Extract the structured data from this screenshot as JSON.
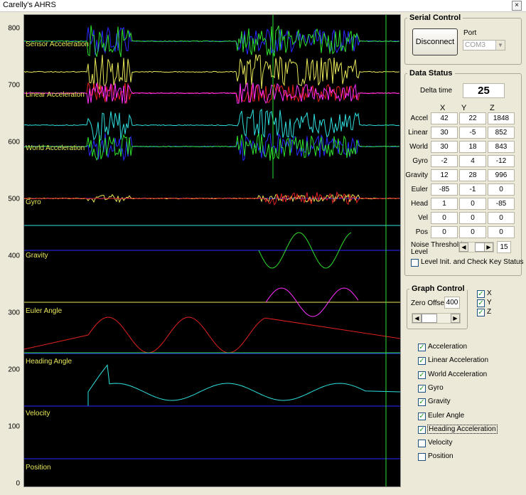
{
  "window": {
    "title": "Carelly's AHRS",
    "close_glyph": "×"
  },
  "y_axis": {
    "ticks": [
      "800",
      "700",
      "600",
      "500",
      "400",
      "300",
      "200",
      "100",
      "0"
    ]
  },
  "graph_labels": [
    "Sensor Acceleration",
    "Linear Acceleraton",
    "World Acceleration",
    "Gyro",
    "Gravity",
    "Euler Angle",
    "Heading Angle",
    "Velocity",
    "Position"
  ],
  "serial_control": {
    "title": "Serial Control",
    "disconnect_label": "Disconnect",
    "port_label": "Port",
    "port_value": "COM3"
  },
  "data_status": {
    "title": "Data Status",
    "delta_time_label": "Delta time",
    "delta_time_value": "25",
    "columns": [
      "X",
      "Y",
      "Z"
    ],
    "rows": [
      {
        "label": "Accel",
        "x": "42",
        "y": "22",
        "z": "1848"
      },
      {
        "label": "Linear",
        "x": "30",
        "y": "-5",
        "z": "852"
      },
      {
        "label": "World",
        "x": "30",
        "y": "18",
        "z": "843"
      },
      {
        "label": "Gyro",
        "x": "-2",
        "y": "4",
        "z": "-12"
      },
      {
        "label": "Gravity",
        "x": "12",
        "y": "28",
        "z": "996"
      },
      {
        "label": "Euler",
        "x": "-85",
        "y": "-1",
        "z": "0"
      },
      {
        "label": "Head",
        "x": "1",
        "y": "0",
        "z": "-85"
      },
      {
        "label": "Vel",
        "x": "0",
        "y": "0",
        "z": "0"
      },
      {
        "label": "Pos",
        "x": "0",
        "y": "0",
        "z": "0"
      }
    ],
    "noise_label_1": "Noise Threshold",
    "noise_label_2": "Level",
    "noise_value": "15",
    "level_check_label": "Level Init. and Check Key Status",
    "level_check_checked": false
  },
  "graph_control": {
    "title": "Graph Control",
    "zero_offset_label": "Zero Offset",
    "zero_offset_value": "400",
    "axes": [
      {
        "label": "X",
        "checked": true
      },
      {
        "label": "Y",
        "checked": true
      },
      {
        "label": "Z",
        "checked": true
      }
    ]
  },
  "plot_toggles": [
    {
      "label": "Acceleration",
      "checked": true
    },
    {
      "label": "Linear Acceleration",
      "checked": true
    },
    {
      "label": "World Acceleration",
      "checked": true
    },
    {
      "label": "Gyro",
      "checked": true
    },
    {
      "label": "Gravity",
      "checked": true
    },
    {
      "label": "Euler Angle",
      "checked": true
    },
    {
      "label": "Heading Acceleration",
      "checked": true,
      "focused": true
    },
    {
      "label": "Velocity",
      "checked": false
    },
    {
      "label": "Position",
      "checked": false
    }
  ],
  "colors": {
    "x": "#e8e85a",
    "y": "#2fe02f",
    "z": "#2a2aff",
    "alt1": "#ff30ff",
    "alt2": "#30e0e0",
    "alt3": "#e02020"
  }
}
